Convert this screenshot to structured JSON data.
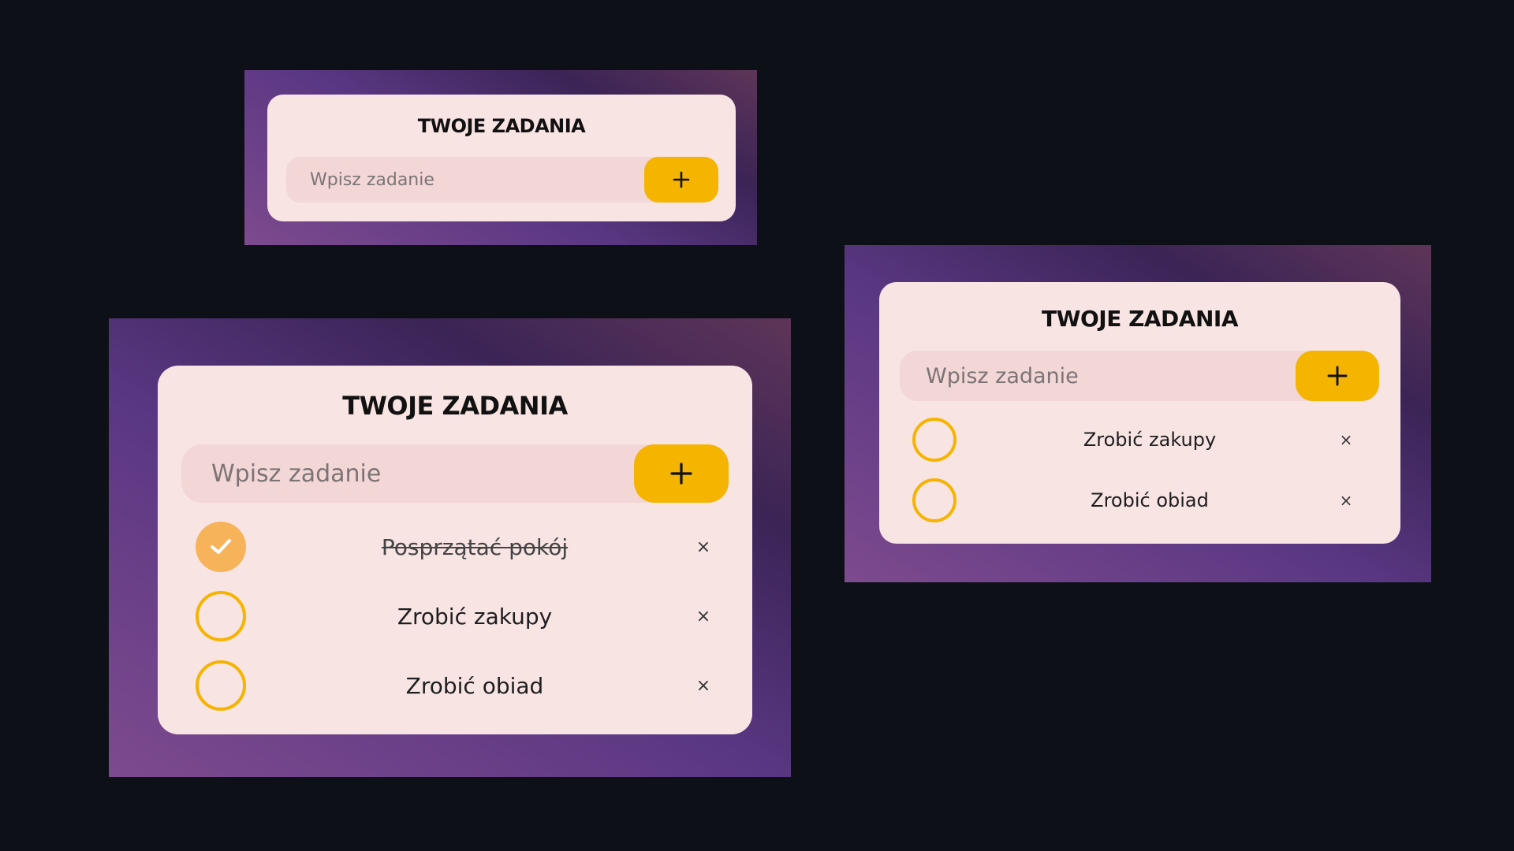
{
  "title": "TWOJE ZADANIA",
  "input_placeholder": "Wpisz zadanie",
  "add_symbol": "+",
  "delete_symbol": "×",
  "check_symbol": "✔",
  "colors": {
    "background": "#0d1017",
    "card": "#f9e4e4",
    "input": "#f3d6d6",
    "accent": "#f5b400",
    "done_check": "#f7b35a"
  },
  "views": {
    "empty": {
      "title": "TWOJE ZADANIA",
      "tasks": []
    },
    "three_tasks": {
      "title": "TWOJE ZADANIA",
      "tasks": [
        {
          "text": "Posprzątać pokój",
          "done": true
        },
        {
          "text": "Zrobić zakupy",
          "done": false
        },
        {
          "text": "Zrobić obiad",
          "done": false
        }
      ]
    },
    "two_tasks": {
      "title": "TWOJE ZADANIA",
      "tasks": [
        {
          "text": "Zrobić zakupy",
          "done": false
        },
        {
          "text": "Zrobić obiad",
          "done": false
        }
      ]
    }
  }
}
